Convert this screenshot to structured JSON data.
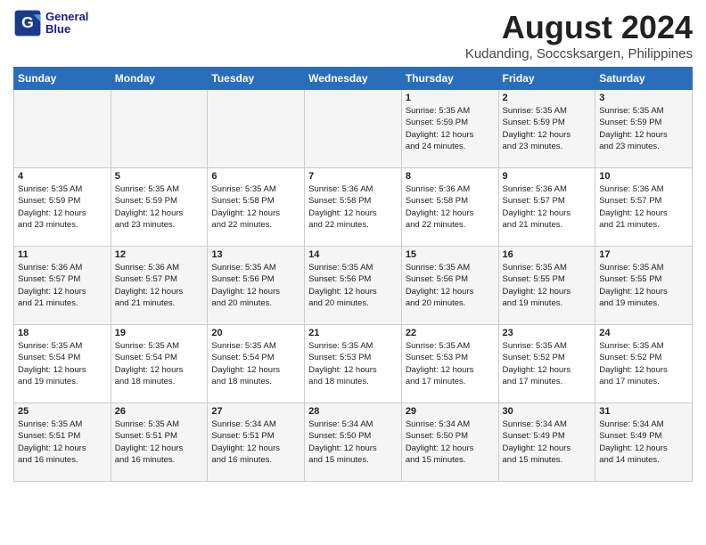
{
  "logo": {
    "line1": "General",
    "line2": "Blue"
  },
  "title": "August 2024",
  "location": "Kudanding, Soccsksargen, Philippines",
  "days_of_week": [
    "Sunday",
    "Monday",
    "Tuesday",
    "Wednesday",
    "Thursday",
    "Friday",
    "Saturday"
  ],
  "weeks": [
    [
      {
        "day": "",
        "text": ""
      },
      {
        "day": "",
        "text": ""
      },
      {
        "day": "",
        "text": ""
      },
      {
        "day": "",
        "text": ""
      },
      {
        "day": "1",
        "text": "Sunrise: 5:35 AM\nSunset: 5:59 PM\nDaylight: 12 hours\nand 24 minutes."
      },
      {
        "day": "2",
        "text": "Sunrise: 5:35 AM\nSunset: 5:59 PM\nDaylight: 12 hours\nand 23 minutes."
      },
      {
        "day": "3",
        "text": "Sunrise: 5:35 AM\nSunset: 5:59 PM\nDaylight: 12 hours\nand 23 minutes."
      }
    ],
    [
      {
        "day": "4",
        "text": "Sunrise: 5:35 AM\nSunset: 5:59 PM\nDaylight: 12 hours\nand 23 minutes."
      },
      {
        "day": "5",
        "text": "Sunrise: 5:35 AM\nSunset: 5:59 PM\nDaylight: 12 hours\nand 23 minutes."
      },
      {
        "day": "6",
        "text": "Sunrise: 5:35 AM\nSunset: 5:58 PM\nDaylight: 12 hours\nand 22 minutes."
      },
      {
        "day": "7",
        "text": "Sunrise: 5:36 AM\nSunset: 5:58 PM\nDaylight: 12 hours\nand 22 minutes."
      },
      {
        "day": "8",
        "text": "Sunrise: 5:36 AM\nSunset: 5:58 PM\nDaylight: 12 hours\nand 22 minutes."
      },
      {
        "day": "9",
        "text": "Sunrise: 5:36 AM\nSunset: 5:57 PM\nDaylight: 12 hours\nand 21 minutes."
      },
      {
        "day": "10",
        "text": "Sunrise: 5:36 AM\nSunset: 5:57 PM\nDaylight: 12 hours\nand 21 minutes."
      }
    ],
    [
      {
        "day": "11",
        "text": "Sunrise: 5:36 AM\nSunset: 5:57 PM\nDaylight: 12 hours\nand 21 minutes."
      },
      {
        "day": "12",
        "text": "Sunrise: 5:36 AM\nSunset: 5:57 PM\nDaylight: 12 hours\nand 21 minutes."
      },
      {
        "day": "13",
        "text": "Sunrise: 5:35 AM\nSunset: 5:56 PM\nDaylight: 12 hours\nand 20 minutes."
      },
      {
        "day": "14",
        "text": "Sunrise: 5:35 AM\nSunset: 5:56 PM\nDaylight: 12 hours\nand 20 minutes."
      },
      {
        "day": "15",
        "text": "Sunrise: 5:35 AM\nSunset: 5:56 PM\nDaylight: 12 hours\nand 20 minutes."
      },
      {
        "day": "16",
        "text": "Sunrise: 5:35 AM\nSunset: 5:55 PM\nDaylight: 12 hours\nand 19 minutes."
      },
      {
        "day": "17",
        "text": "Sunrise: 5:35 AM\nSunset: 5:55 PM\nDaylight: 12 hours\nand 19 minutes."
      }
    ],
    [
      {
        "day": "18",
        "text": "Sunrise: 5:35 AM\nSunset: 5:54 PM\nDaylight: 12 hours\nand 19 minutes."
      },
      {
        "day": "19",
        "text": "Sunrise: 5:35 AM\nSunset: 5:54 PM\nDaylight: 12 hours\nand 18 minutes."
      },
      {
        "day": "20",
        "text": "Sunrise: 5:35 AM\nSunset: 5:54 PM\nDaylight: 12 hours\nand 18 minutes."
      },
      {
        "day": "21",
        "text": "Sunrise: 5:35 AM\nSunset: 5:53 PM\nDaylight: 12 hours\nand 18 minutes."
      },
      {
        "day": "22",
        "text": "Sunrise: 5:35 AM\nSunset: 5:53 PM\nDaylight: 12 hours\nand 17 minutes."
      },
      {
        "day": "23",
        "text": "Sunrise: 5:35 AM\nSunset: 5:52 PM\nDaylight: 12 hours\nand 17 minutes."
      },
      {
        "day": "24",
        "text": "Sunrise: 5:35 AM\nSunset: 5:52 PM\nDaylight: 12 hours\nand 17 minutes."
      }
    ],
    [
      {
        "day": "25",
        "text": "Sunrise: 5:35 AM\nSunset: 5:51 PM\nDaylight: 12 hours\nand 16 minutes."
      },
      {
        "day": "26",
        "text": "Sunrise: 5:35 AM\nSunset: 5:51 PM\nDaylight: 12 hours\nand 16 minutes."
      },
      {
        "day": "27",
        "text": "Sunrise: 5:34 AM\nSunset: 5:51 PM\nDaylight: 12 hours\nand 16 minutes."
      },
      {
        "day": "28",
        "text": "Sunrise: 5:34 AM\nSunset: 5:50 PM\nDaylight: 12 hours\nand 15 minutes."
      },
      {
        "day": "29",
        "text": "Sunrise: 5:34 AM\nSunset: 5:50 PM\nDaylight: 12 hours\nand 15 minutes."
      },
      {
        "day": "30",
        "text": "Sunrise: 5:34 AM\nSunset: 5:49 PM\nDaylight: 12 hours\nand 15 minutes."
      },
      {
        "day": "31",
        "text": "Sunrise: 5:34 AM\nSunset: 5:49 PM\nDaylight: 12 hours\nand 14 minutes."
      }
    ]
  ]
}
